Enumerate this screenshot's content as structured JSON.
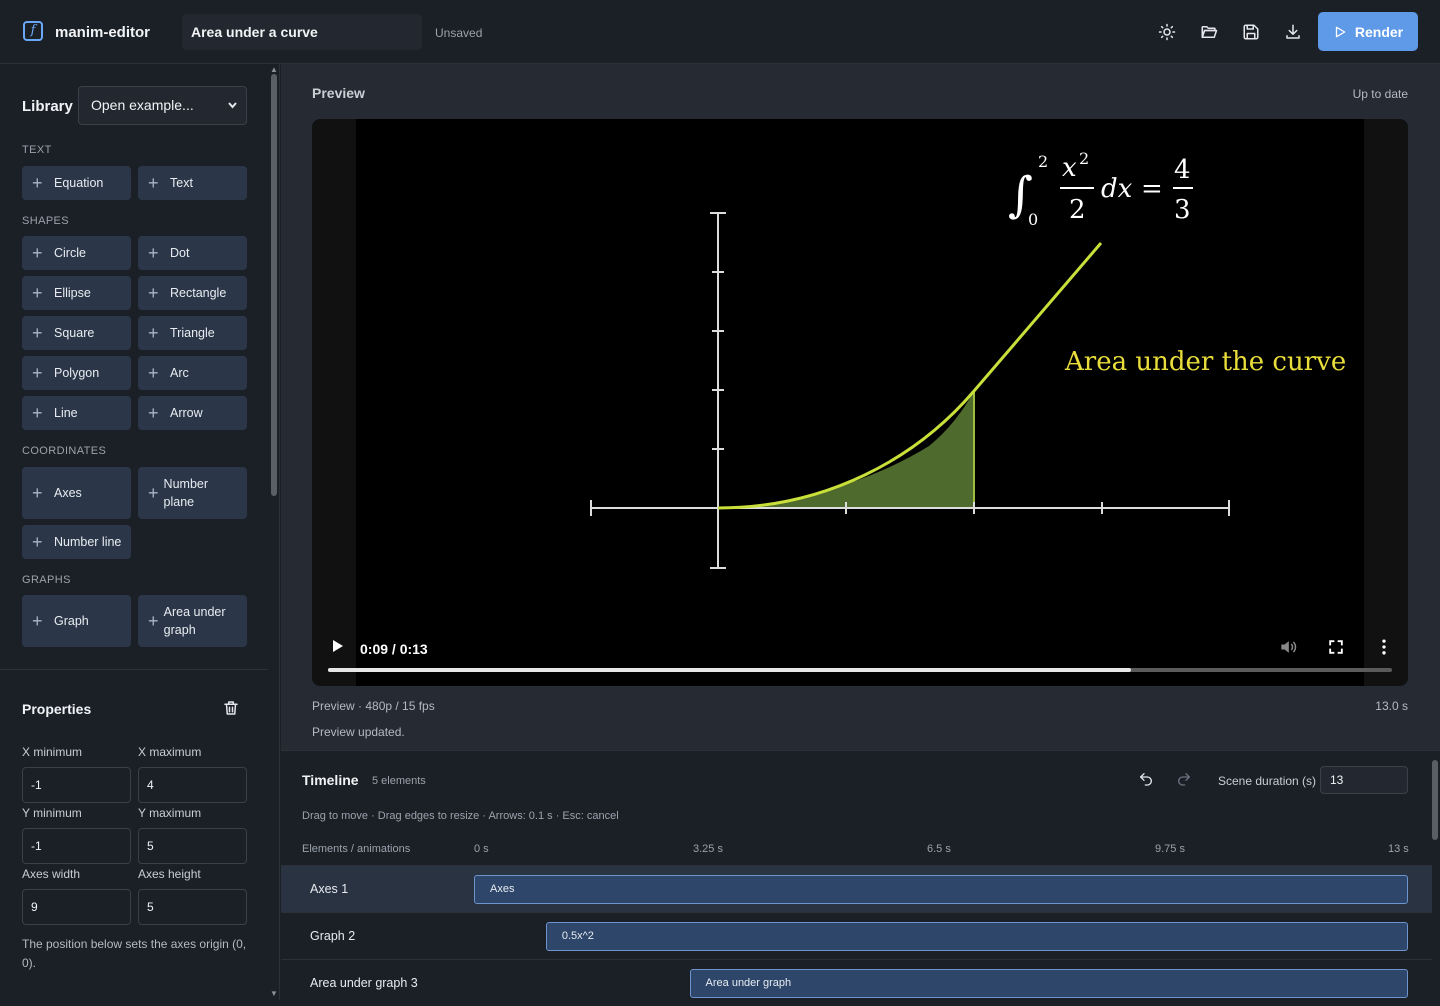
{
  "header": {
    "app_name": "manim-editor",
    "scene_title": "Area under a curve",
    "save_status": "Unsaved",
    "render_label": "Render"
  },
  "library": {
    "label": "Library",
    "select_value": "Open example...",
    "sections": [
      {
        "title": "TEXT",
        "items": [
          "Equation",
          "Text"
        ]
      },
      {
        "title": "SHAPES",
        "items": [
          "Circle",
          "Dot",
          "Ellipse",
          "Rectangle",
          "Square",
          "Triangle",
          "Polygon",
          "Arc",
          "Line",
          "Arrow"
        ]
      },
      {
        "title": "COORDINATES",
        "items": [
          "Axes",
          "Number plane",
          "Number line"
        ]
      },
      {
        "title": "GRAPHS",
        "items": [
          "Graph",
          "Area under graph"
        ]
      }
    ]
  },
  "properties": {
    "title": "Properties",
    "fields": [
      {
        "label": "X minimum",
        "value": "-1"
      },
      {
        "label": "X maximum",
        "value": "4"
      },
      {
        "label": "Y minimum",
        "value": "-1"
      },
      {
        "label": "Y maximum",
        "value": "5"
      },
      {
        "label": "Axes width",
        "value": "9"
      },
      {
        "label": "Axes height",
        "value": "5"
      }
    ],
    "note": "The position below sets the axes origin (0, 0)."
  },
  "preview": {
    "label": "Preview",
    "status_right": "Up to date",
    "time_display": "0:09 / 0:13",
    "progress": 0.755,
    "meta": "Preview · 480p / 15 fps",
    "duration": "13.0 s",
    "status": "Preview updated.",
    "scene_text": "Area under the curve",
    "equation": {
      "upper": "2",
      "lower": "0",
      "num": "x",
      "exp": "2",
      "den": "2",
      "dx": "dx",
      "eq": "=",
      "rnum": "4",
      "rden": "3"
    }
  },
  "timeline": {
    "title": "Timeline",
    "count": "5 elements",
    "duration_label": "Scene duration (s)",
    "duration_value": "13",
    "hint": "Drag to move · Drag edges to resize · Arrows: 0.1 s · Esc: cancel",
    "col_header": "Elements / animations",
    "ticks": [
      "0 s",
      "3.25 s",
      "6.5 s",
      "9.75 s",
      "13 s"
    ],
    "rows": [
      {
        "name": "Axes 1",
        "bar": "Axes",
        "start": 0,
        "end": 13
      },
      {
        "name": "Graph 2",
        "bar": "0.5x^2",
        "start": 1,
        "end": 13
      },
      {
        "name": "Area under graph 3",
        "bar": "Area under graph",
        "start": 3,
        "end": 13
      }
    ]
  },
  "colors": {
    "accent": "#5e9ae8",
    "curve": "#c9df3a",
    "area": "#4e6a2c",
    "scene_text": "#e8dd3a"
  }
}
